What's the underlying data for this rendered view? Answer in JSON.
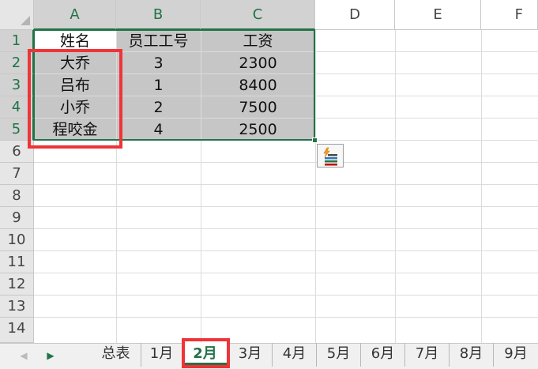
{
  "columns": [
    "A",
    "B",
    "C",
    "D",
    "E",
    "F"
  ],
  "rows": [
    "1",
    "2",
    "3",
    "4",
    "5",
    "6",
    "7",
    "8",
    "9",
    "10",
    "11",
    "12",
    "13",
    "14"
  ],
  "table": {
    "headers": [
      "姓名",
      "员工工号",
      "工资"
    ],
    "records": [
      [
        "大乔",
        "3",
        "2300"
      ],
      [
        "吕布",
        "1",
        "8400"
      ],
      [
        "小乔",
        "2",
        "7500"
      ],
      [
        "程咬金",
        "4",
        "2500"
      ]
    ]
  },
  "sheet_tabs": [
    "总表",
    "1月",
    "2月",
    "3月",
    "4月",
    "5月",
    "6月",
    "7月",
    "8月",
    "9月"
  ],
  "active_tab": "2月",
  "quick_analysis_icon": "quick-analysis-icon",
  "colors": {
    "accent": "#217346",
    "highlight": "#ee3438",
    "selection": "#c6c6c6"
  }
}
